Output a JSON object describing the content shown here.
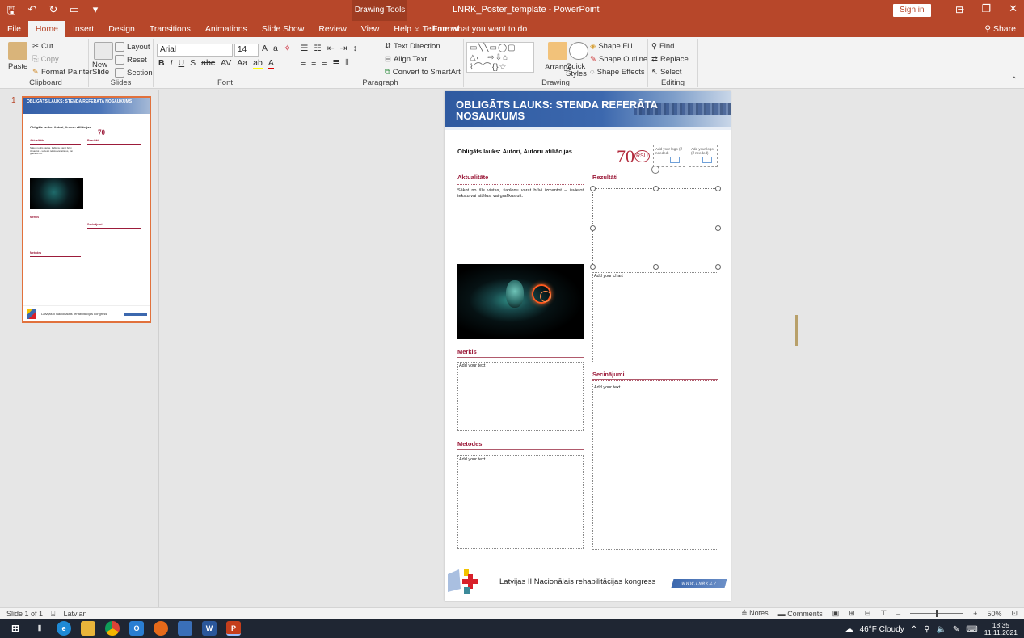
{
  "window": {
    "context_tab_label": "Drawing Tools",
    "title": "LNRK_Poster_template - PowerPoint",
    "signin_label": "Sign in"
  },
  "tabs": [
    {
      "label": "File"
    },
    {
      "label": "Home"
    },
    {
      "label": "Insert"
    },
    {
      "label": "Design"
    },
    {
      "label": "Transitions"
    },
    {
      "label": "Animations"
    },
    {
      "label": "Slide Show"
    },
    {
      "label": "Review"
    },
    {
      "label": "View"
    },
    {
      "label": "Help"
    },
    {
      "label": "Format"
    }
  ],
  "tell_me": "Tell me what you want to do",
  "share_label": "Share",
  "ribbon": {
    "clipboard": {
      "paste": "Paste",
      "cut": "Cut",
      "copy": "Copy",
      "format_painter": "Format Painter",
      "label": "Clipboard"
    },
    "slides": {
      "new_slide": "New Slide",
      "layout": "Layout",
      "reset": "Reset",
      "section": "Section",
      "label": "Slides"
    },
    "font": {
      "name": "Arial",
      "size": "14",
      "label": "Font"
    },
    "paragraph": {
      "text_direction": "Text Direction",
      "align_text": "Align Text",
      "convert": "Convert to SmartArt",
      "label": "Paragraph"
    },
    "drawing": {
      "arrange": "Arrange",
      "quick_styles": "Quick Styles",
      "shape_fill": "Shape Fill",
      "shape_outline": "Shape Outline",
      "shape_effects": "Shape Effects",
      "label": "Drawing"
    },
    "editing": {
      "find": "Find",
      "replace": "Replace",
      "select": "Select",
      "label": "Editing"
    }
  },
  "thumbnail": {
    "number": "1",
    "title": "OBLIGĀTS LAUKS: STENDA REFERĀTA NOSAUKUMS",
    "authors": "Obligāts lauks: Autori, Autoru afiliācijas",
    "s1": "Aktualitāte",
    "s2": "Rezultāti",
    "body": "Sākot no šīs vietas, šablonu varat brīvi izmantot – ievietot tekstu vai attēlus, vai grafikus utt.",
    "s3": "Mērķis",
    "s4": "Secinājumi",
    "s5": "Metodes",
    "footer": "Latvijas II Nacionālais rehabilitācijas kongress"
  },
  "slide": {
    "title": "OBLIGĀTS LAUKS: STENDA REFERĀTA NOSAUKUMS",
    "authors": "Obligāts lauks: Autori, Autoru afiliācijas",
    "logo_70": "70",
    "logo_rsu": "RSU",
    "logo_placeholder_1": "Add your logo (if needed)",
    "logo_placeholder_2": "Add your logo (if needed)",
    "sections": {
      "aktualitate": "Aktualitāte",
      "rezultati": "Rezultāti",
      "merkis": "Mērķis",
      "metodes": "Metodes",
      "secinajumi": "Secinājumi"
    },
    "body_text": "Sākot no šīs vietas, šablonu varat brīvi izmantot – ievietot tekstu vai attēlus, vai grafikus utt.",
    "chart_placeholder": "Add your chart",
    "text_placeholder": "Add your text",
    "footer_text": "Latvijas II Nacionālais rehabilitācijas kongress",
    "footer_badge": "WWW.LNRK.LV"
  },
  "status": {
    "slide_info": "Slide 1 of 1",
    "language": "Latvian",
    "notes": "Notes",
    "comments": "Comments",
    "zoom": "50%"
  },
  "taskbar": {
    "weather": "46°F Cloudy",
    "time": "18:35",
    "date": "11.11.2021"
  }
}
